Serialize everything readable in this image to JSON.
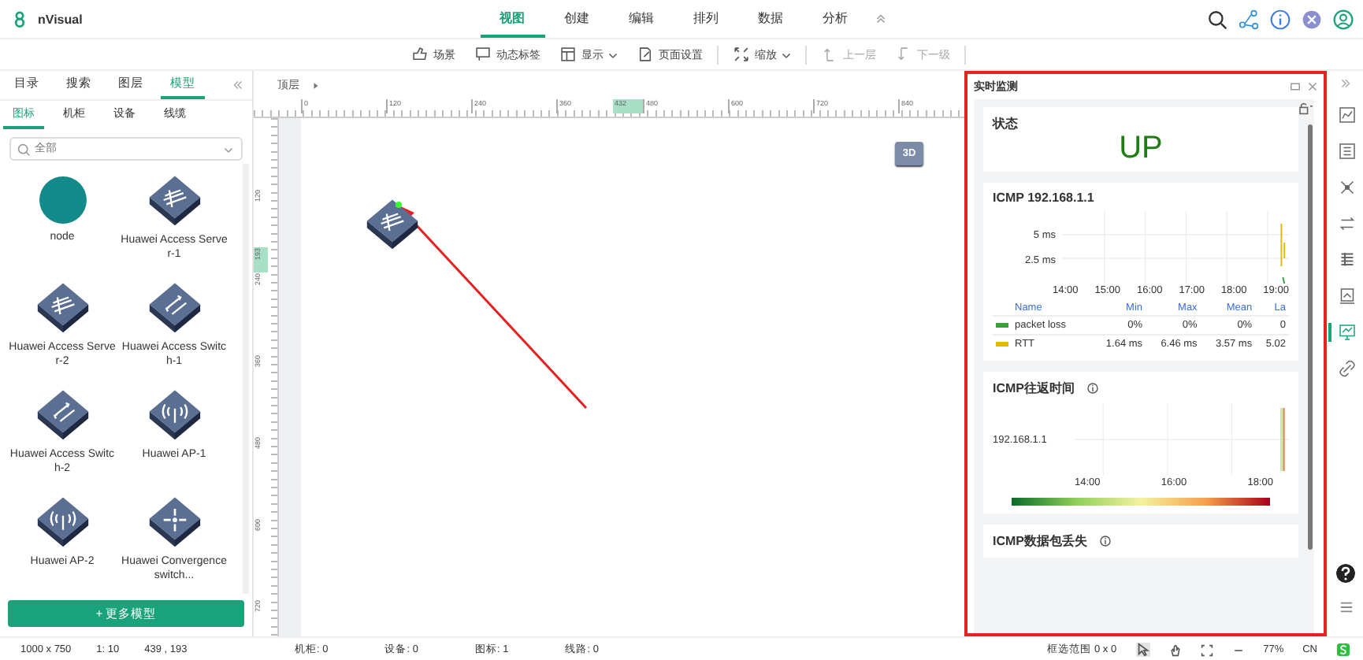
{
  "app": {
    "name": "nVisual"
  },
  "menu": [
    {
      "label": "视图",
      "selected": true
    },
    {
      "label": "创建",
      "selected": false
    },
    {
      "label": "编辑",
      "selected": false
    },
    {
      "label": "排列",
      "selected": false
    },
    {
      "label": "数据",
      "selected": false
    },
    {
      "label": "分析",
      "selected": false
    }
  ],
  "toolbar": [
    {
      "label": "场景",
      "kind": "scene",
      "dropdown": false,
      "disabled": false,
      "divider_after": false
    },
    {
      "label": "动态标签",
      "kind": "tag",
      "dropdown": false,
      "disabled": false,
      "divider_after": false
    },
    {
      "label": "显示",
      "kind": "display",
      "dropdown": true,
      "disabled": false,
      "divider_after": false
    },
    {
      "label": "页面设置",
      "kind": "page",
      "dropdown": false,
      "disabled": false,
      "divider_after": true
    },
    {
      "label": "缩放",
      "kind": "zoom",
      "dropdown": true,
      "disabled": false,
      "divider_after": true
    },
    {
      "label": "上一层",
      "kind": "up",
      "dropdown": false,
      "disabled": true,
      "divider_after": false
    },
    {
      "label": "下一级",
      "kind": "down",
      "dropdown": false,
      "disabled": true,
      "divider_after": true
    }
  ],
  "left_panel": {
    "tabs": [
      {
        "label": "目录",
        "selected": false
      },
      {
        "label": "搜索",
        "selected": false
      },
      {
        "label": "图层",
        "selected": false
      },
      {
        "label": "模型",
        "selected": true
      }
    ],
    "subtabs": [
      {
        "label": "图标",
        "selected": true
      },
      {
        "label": "机柜",
        "selected": false
      },
      {
        "label": "设备",
        "selected": false
      },
      {
        "label": "线缆",
        "selected": false
      }
    ],
    "search": {
      "placeholder": "全部"
    },
    "models": [
      {
        "label": "node",
        "kind": "node"
      },
      {
        "label": "Huawei Access Server-1",
        "kind": "server"
      },
      {
        "label": "Huawei Access Server-2",
        "kind": "server"
      },
      {
        "label": "Huawei Access Switch-1",
        "kind": "switch"
      },
      {
        "label": "Huawei Access Switch-2",
        "kind": "switch"
      },
      {
        "label": "Huawei AP-1",
        "kind": "ap"
      },
      {
        "label": "Huawei AP-2",
        "kind": "ap"
      },
      {
        "label": "Huawei Convergence switch...",
        "kind": "convergence"
      }
    ],
    "more_button": "+ 更多模型"
  },
  "canvas": {
    "breadcrumb": "顶层",
    "ruler_top": [
      {
        "label": "0",
        "highlighted": false
      },
      {
        "label": "120",
        "highlighted": false
      },
      {
        "label": "240",
        "highlighted": false
      },
      {
        "label": "360",
        "highlighted": false
      },
      {
        "label": "432",
        "highlighted": true
      },
      {
        "label": "480",
        "highlighted": false
      },
      {
        "label": "600",
        "highlighted": false
      },
      {
        "label": "720",
        "highlighted": false
      },
      {
        "label": "840",
        "highlighted": false
      }
    ],
    "ruler_left": [
      {
        "label": "120",
        "highlighted": false
      },
      {
        "label": "193",
        "highlighted": true
      },
      {
        "label": "240",
        "highlighted": false
      },
      {
        "label": "360",
        "highlighted": false
      },
      {
        "label": "480",
        "highlighted": false
      },
      {
        "label": "600",
        "highlighted": false
      },
      {
        "label": "720",
        "highlighted": false
      }
    ],
    "view_button": "3D"
  },
  "monitor": {
    "title": "实时监测",
    "status_card": {
      "title": "状态",
      "value": "UP"
    },
    "icmp_card": {
      "title": "ICMP 192.168.1.1",
      "y_ticks": [
        "5 ms",
        "2.5 ms"
      ],
      "x_ticks": [
        "14:00",
        "15:00",
        "16:00",
        "17:00",
        "18:00",
        "19:00"
      ],
      "columns": [
        "Name",
        "Min",
        "Max",
        "Mean",
        "La"
      ],
      "rows": [
        {
          "color": "#3aa13a",
          "cells": [
            "packet loss",
            "0%",
            "0%",
            "0%",
            "0"
          ]
        },
        {
          "color": "#e6b800",
          "cells": [
            "RTT",
            "1.64 ms",
            "6.46 ms",
            "3.57 ms",
            "5.02"
          ]
        }
      ]
    },
    "rtt_card": {
      "title": "ICMP往返时间",
      "y_label": "192.168.1.1",
      "x_ticks": [
        "14:00",
        "16:00",
        "18:00"
      ]
    },
    "loss_card": {
      "title": "ICMP数据包丢失"
    }
  },
  "right_sidebar": [
    {
      "kind": "chart",
      "selected": false
    },
    {
      "kind": "list",
      "selected": false
    },
    {
      "kind": "network",
      "selected": false
    },
    {
      "kind": "swap",
      "selected": false
    },
    {
      "kind": "grid",
      "selected": false
    },
    {
      "kind": "report",
      "selected": false
    },
    {
      "kind": "monitor",
      "selected": true
    },
    {
      "kind": "link",
      "selected": false
    }
  ],
  "status_bar": {
    "size": "1000 x 750",
    "scale": "1: 10",
    "position": "439 , 193",
    "counts": [
      "机柜: 0",
      "设备: 0",
      "图标: 1",
      "线路: 0"
    ],
    "selection": "框选范围 0 x 0",
    "zoom": "77%",
    "language": "CN"
  }
}
